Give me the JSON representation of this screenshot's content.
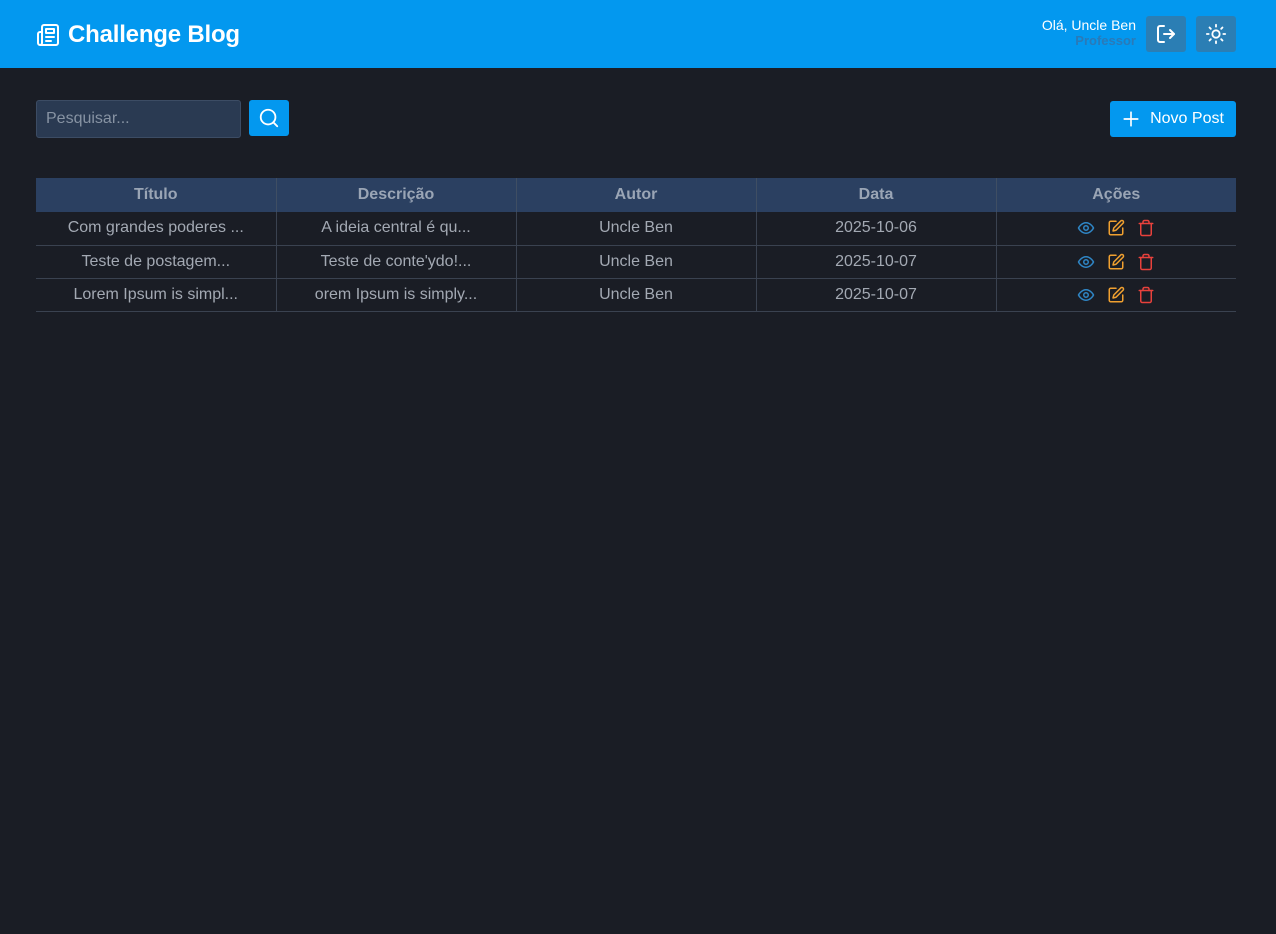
{
  "header": {
    "brand_title": "Challenge Blog",
    "greeting": "Olá, Uncle Ben",
    "role": "Professor"
  },
  "toolbar": {
    "search_placeholder": "Pesquisar...",
    "new_post_label": "Novo Post"
  },
  "table": {
    "columns": [
      "Título",
      "Descrição",
      "Autor",
      "Data",
      "Ações"
    ],
    "rows": [
      {
        "titulo": "Com grandes poderes ...",
        "descricao": "A ideia central é qu...",
        "autor": "Uncle Ben",
        "data": "2025-10-06"
      },
      {
        "titulo": "Teste de postagem...",
        "descricao": "Teste de conte'ydo!...",
        "autor": "Uncle Ben",
        "data": "2025-10-07"
      },
      {
        "titulo": "Lorem Ipsum is simpl...",
        "descricao": "orem Ipsum is simply...",
        "autor": "Uncle Ben",
        "data": "2025-10-07"
      }
    ]
  },
  "colors": {
    "header_bg": "#0398ef",
    "page_bg": "#1a1d25",
    "view_icon": "#2f86c6",
    "edit_icon": "#f0a030",
    "delete_icon": "#e8413c"
  },
  "icons": {
    "brand": "newspaper-icon",
    "logout": "logout-icon",
    "theme": "sun-icon",
    "search": "search-icon",
    "new_post": "plus-icon",
    "view": "eye-icon",
    "edit": "edit-icon",
    "delete": "trash-icon"
  }
}
